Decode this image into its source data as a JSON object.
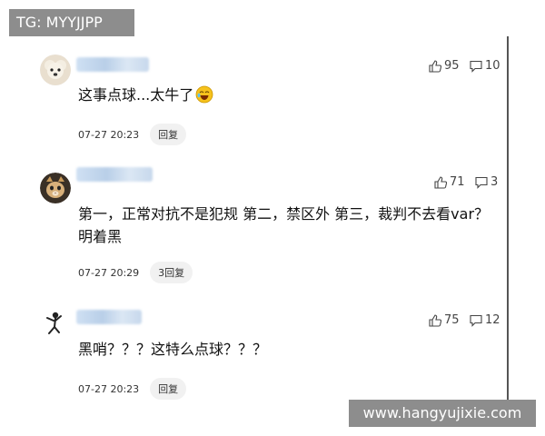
{
  "tg_badge": "TG: MYYJJPP",
  "watermark": "www.hangyujixie.com",
  "comments": [
    {
      "avatar_icon": "poodle-dog-avatar",
      "likes": "95",
      "replies": "10",
      "text": "这事点球...太牛了",
      "time": "07-27 20:23",
      "reply_label": "回复"
    },
    {
      "avatar_icon": "cat-avatar",
      "likes": "71",
      "replies": "3",
      "text": "第一，正常对抗不是犯规 第二，禁区外 第三，裁判不去看var？ 明着黑",
      "time": "07-27 20:29",
      "reply_label": "3回复"
    },
    {
      "avatar_icon": "dancer-avatar",
      "likes": "75",
      "replies": "12",
      "text": "黑哨？？？这特么点球？？？",
      "time": "07-27 20:23",
      "reply_label": "回复"
    }
  ]
}
